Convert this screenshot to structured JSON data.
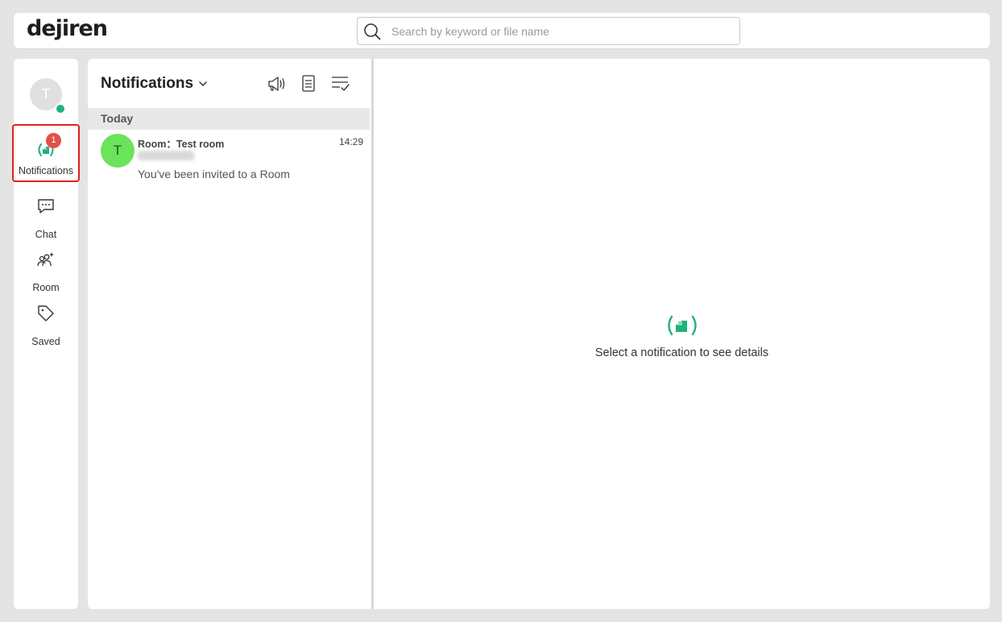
{
  "app": {
    "logo": "dejiren"
  },
  "search": {
    "placeholder": "Search by keyword or file name",
    "value": ""
  },
  "user": {
    "initial": "T",
    "status": "online"
  },
  "nav": {
    "items": [
      {
        "label": "Notifications",
        "icon": "notifications-icon",
        "badge": "1",
        "active": true
      },
      {
        "label": "Chat",
        "icon": "chat-icon"
      },
      {
        "label": "Room",
        "icon": "room-icon"
      },
      {
        "label": "Saved",
        "icon": "tag-icon"
      }
    ]
  },
  "list": {
    "title": "Notifications",
    "section": "Today",
    "items": [
      {
        "avatar": "T",
        "title": "Room：Test room",
        "time": "14:29",
        "message": "You've been invited to a Room"
      }
    ]
  },
  "detail": {
    "empty_text": "Select a notification to see details"
  },
  "colors": {
    "accent": "#20b27a",
    "badge": "#e2504a",
    "highlight": "#e02020"
  }
}
